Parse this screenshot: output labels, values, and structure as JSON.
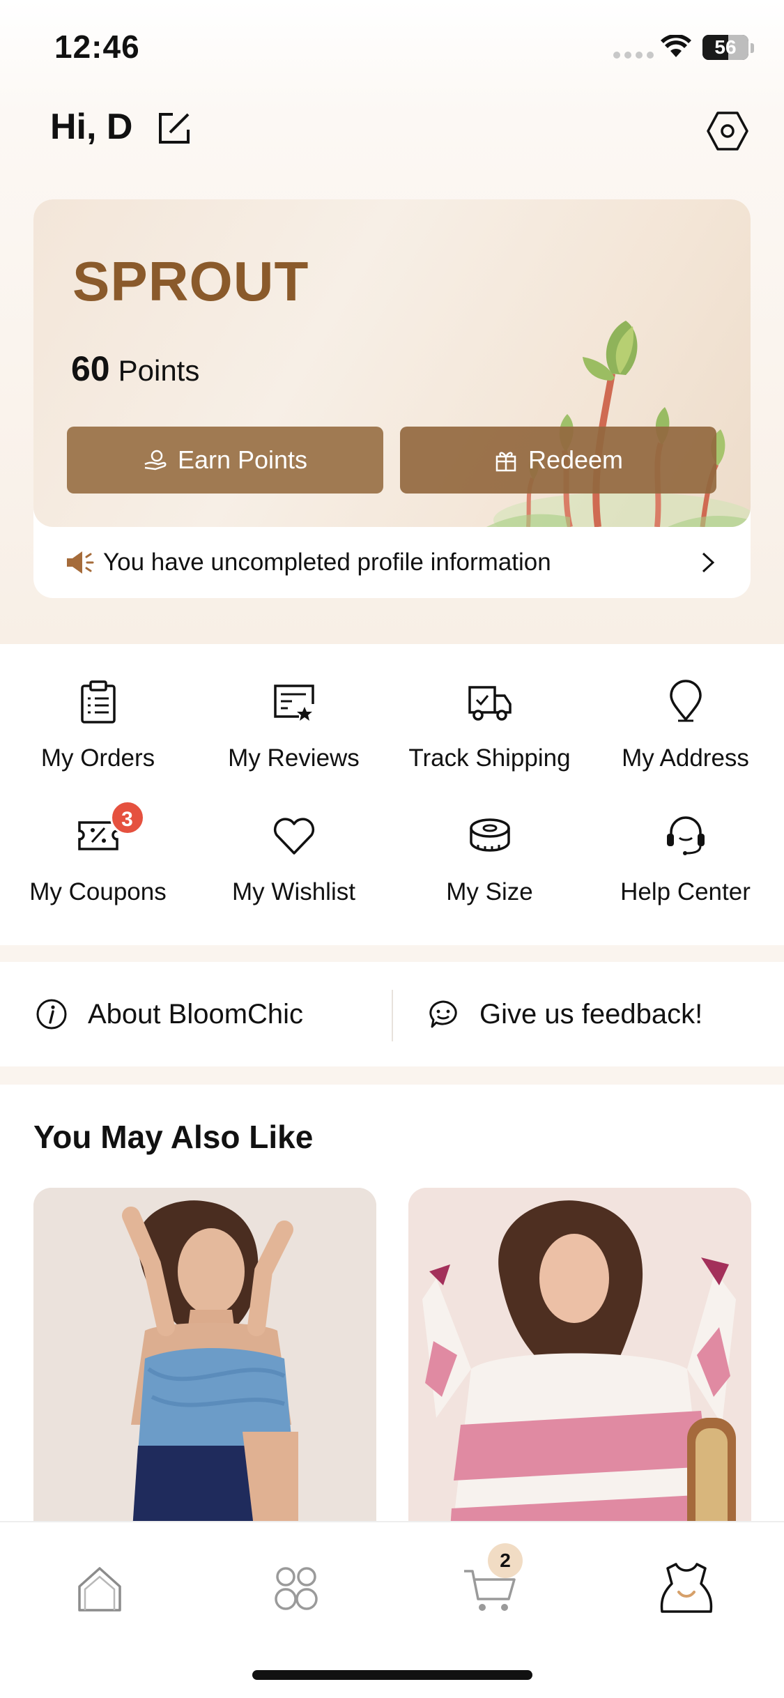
{
  "status_bar": {
    "time": "12:46",
    "battery_level": "56",
    "battery_fraction": 0.56
  },
  "header": {
    "greeting": "Hi, D"
  },
  "membership": {
    "tier": "SPROUT",
    "points_value": "60",
    "points_label": "Points",
    "earn_label": "Earn Points",
    "redeem_label": "Redeem",
    "profile_notice": "You have uncompleted profile information"
  },
  "shortcuts": [
    {
      "label": "My Orders",
      "icon": "clipboard-icon"
    },
    {
      "label": "My Reviews",
      "icon": "review-star-icon"
    },
    {
      "label": "Track Shipping",
      "icon": "truck-icon"
    },
    {
      "label": "My Address",
      "icon": "location-pin-icon"
    },
    {
      "label": "My Coupons",
      "icon": "coupon-icon",
      "badge": "3"
    },
    {
      "label": "My Wishlist",
      "icon": "heart-icon"
    },
    {
      "label": "My Size",
      "icon": "measuring-tape-icon"
    },
    {
      "label": "Help Center",
      "icon": "headset-icon"
    }
  ],
  "info_links": {
    "about": "About BloomChic",
    "feedback": "Give us feedback!"
  },
  "recommendations": {
    "title": "You May Also Like"
  },
  "tab_bar": {
    "cart_badge": "2",
    "tabs": [
      "home-icon",
      "categories-icon",
      "cart-icon",
      "account-dress-icon"
    ]
  },
  "colors": {
    "brand_brown": "#8a5a2b",
    "button_brown": "#a07a52",
    "badge_red": "#e5513f",
    "cart_badge_bg": "#f1dcc4"
  }
}
